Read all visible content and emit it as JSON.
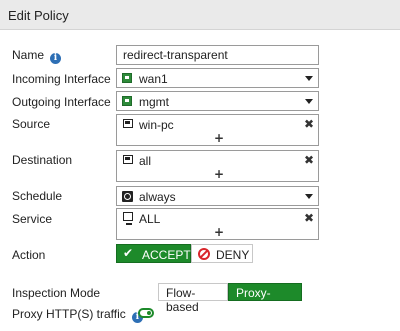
{
  "header": {
    "title": "Edit Policy"
  },
  "form": {
    "name": {
      "label": "Name",
      "value": "redirect-transparent"
    },
    "incoming": {
      "label": "Incoming Interface",
      "value": "wan1",
      "icon": "interface-port-icon"
    },
    "outgoing": {
      "label": "Outgoing Interface",
      "value": "mgmt",
      "icon": "interface-port-icon"
    },
    "source": {
      "label": "Source",
      "items": [
        "win-pc"
      ],
      "add": "+",
      "remove": "✖"
    },
    "destination": {
      "label": "Destination",
      "items": [
        "all"
      ],
      "add": "+",
      "remove": "✖"
    },
    "schedule": {
      "label": "Schedule",
      "value": "always"
    },
    "service": {
      "label": "Service",
      "items": [
        "ALL"
      ],
      "add": "+",
      "remove": "✖"
    },
    "action": {
      "label": "Action",
      "accept": "ACCEPT",
      "deny": "DENY",
      "accept_check": "✔",
      "selected": "ACCEPT"
    },
    "inspection_mode": {
      "label": "Inspection Mode",
      "options": [
        "Flow-based",
        "Proxy-based"
      ],
      "selected": "Proxy-based"
    },
    "proxy_http": {
      "label": "Proxy HTTP(S) traffic",
      "enabled": true
    }
  },
  "colors": {
    "accent_green": "#1d8a2a",
    "info_blue": "#2d6fb5",
    "deny_red": "#d9262c",
    "header_bg": "#eaeaea"
  }
}
